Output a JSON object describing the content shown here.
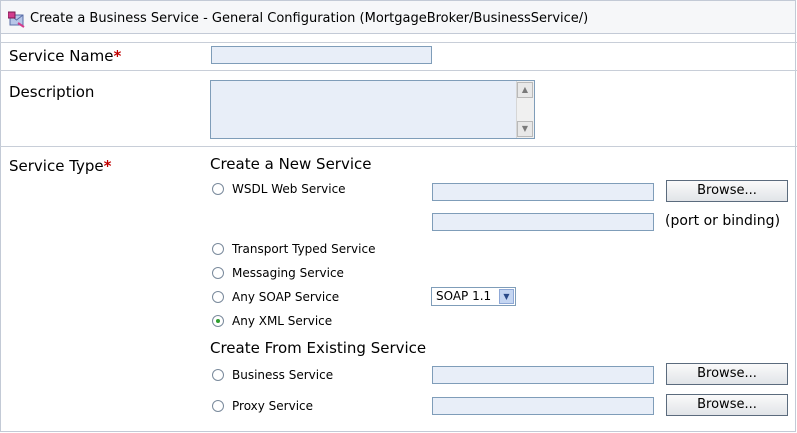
{
  "header": {
    "title": "Create a Business Service - General Configuration (MortgageBroker/BusinessService/)"
  },
  "form": {
    "service_name": {
      "label": "Service Name",
      "required_mark": "*",
      "value": ""
    },
    "description": {
      "label": "Description",
      "value": ""
    },
    "service_type": {
      "label": "Service Type",
      "required_mark": "*",
      "new_section_title": "Create a New Service",
      "existing_section_title": "Create From Existing Service",
      "options": {
        "wsdl": "WSDL Web Service",
        "transport_typed": "Transport Typed Service",
        "messaging": "Messaging Service",
        "any_soap": "Any SOAP Service",
        "any_xml": "Any XML Service",
        "business": "Business Service",
        "proxy": "Proxy Service"
      },
      "selected": "Any XML Service",
      "soap_version": "SOAP 1.1",
      "port_binding_hint": "(port or binding)",
      "browse_label": "Browse..."
    }
  },
  "icons": {
    "header_icon": "business-service-icon",
    "scroll_up": "scroll-up-icon",
    "scroll_down": "scroll-down-icon",
    "dropdown_arrow": "chevron-down-icon"
  },
  "colors": {
    "input_bg": "#e8eef8",
    "required": "#c00000",
    "radio_selected": "#2f9e2f"
  }
}
